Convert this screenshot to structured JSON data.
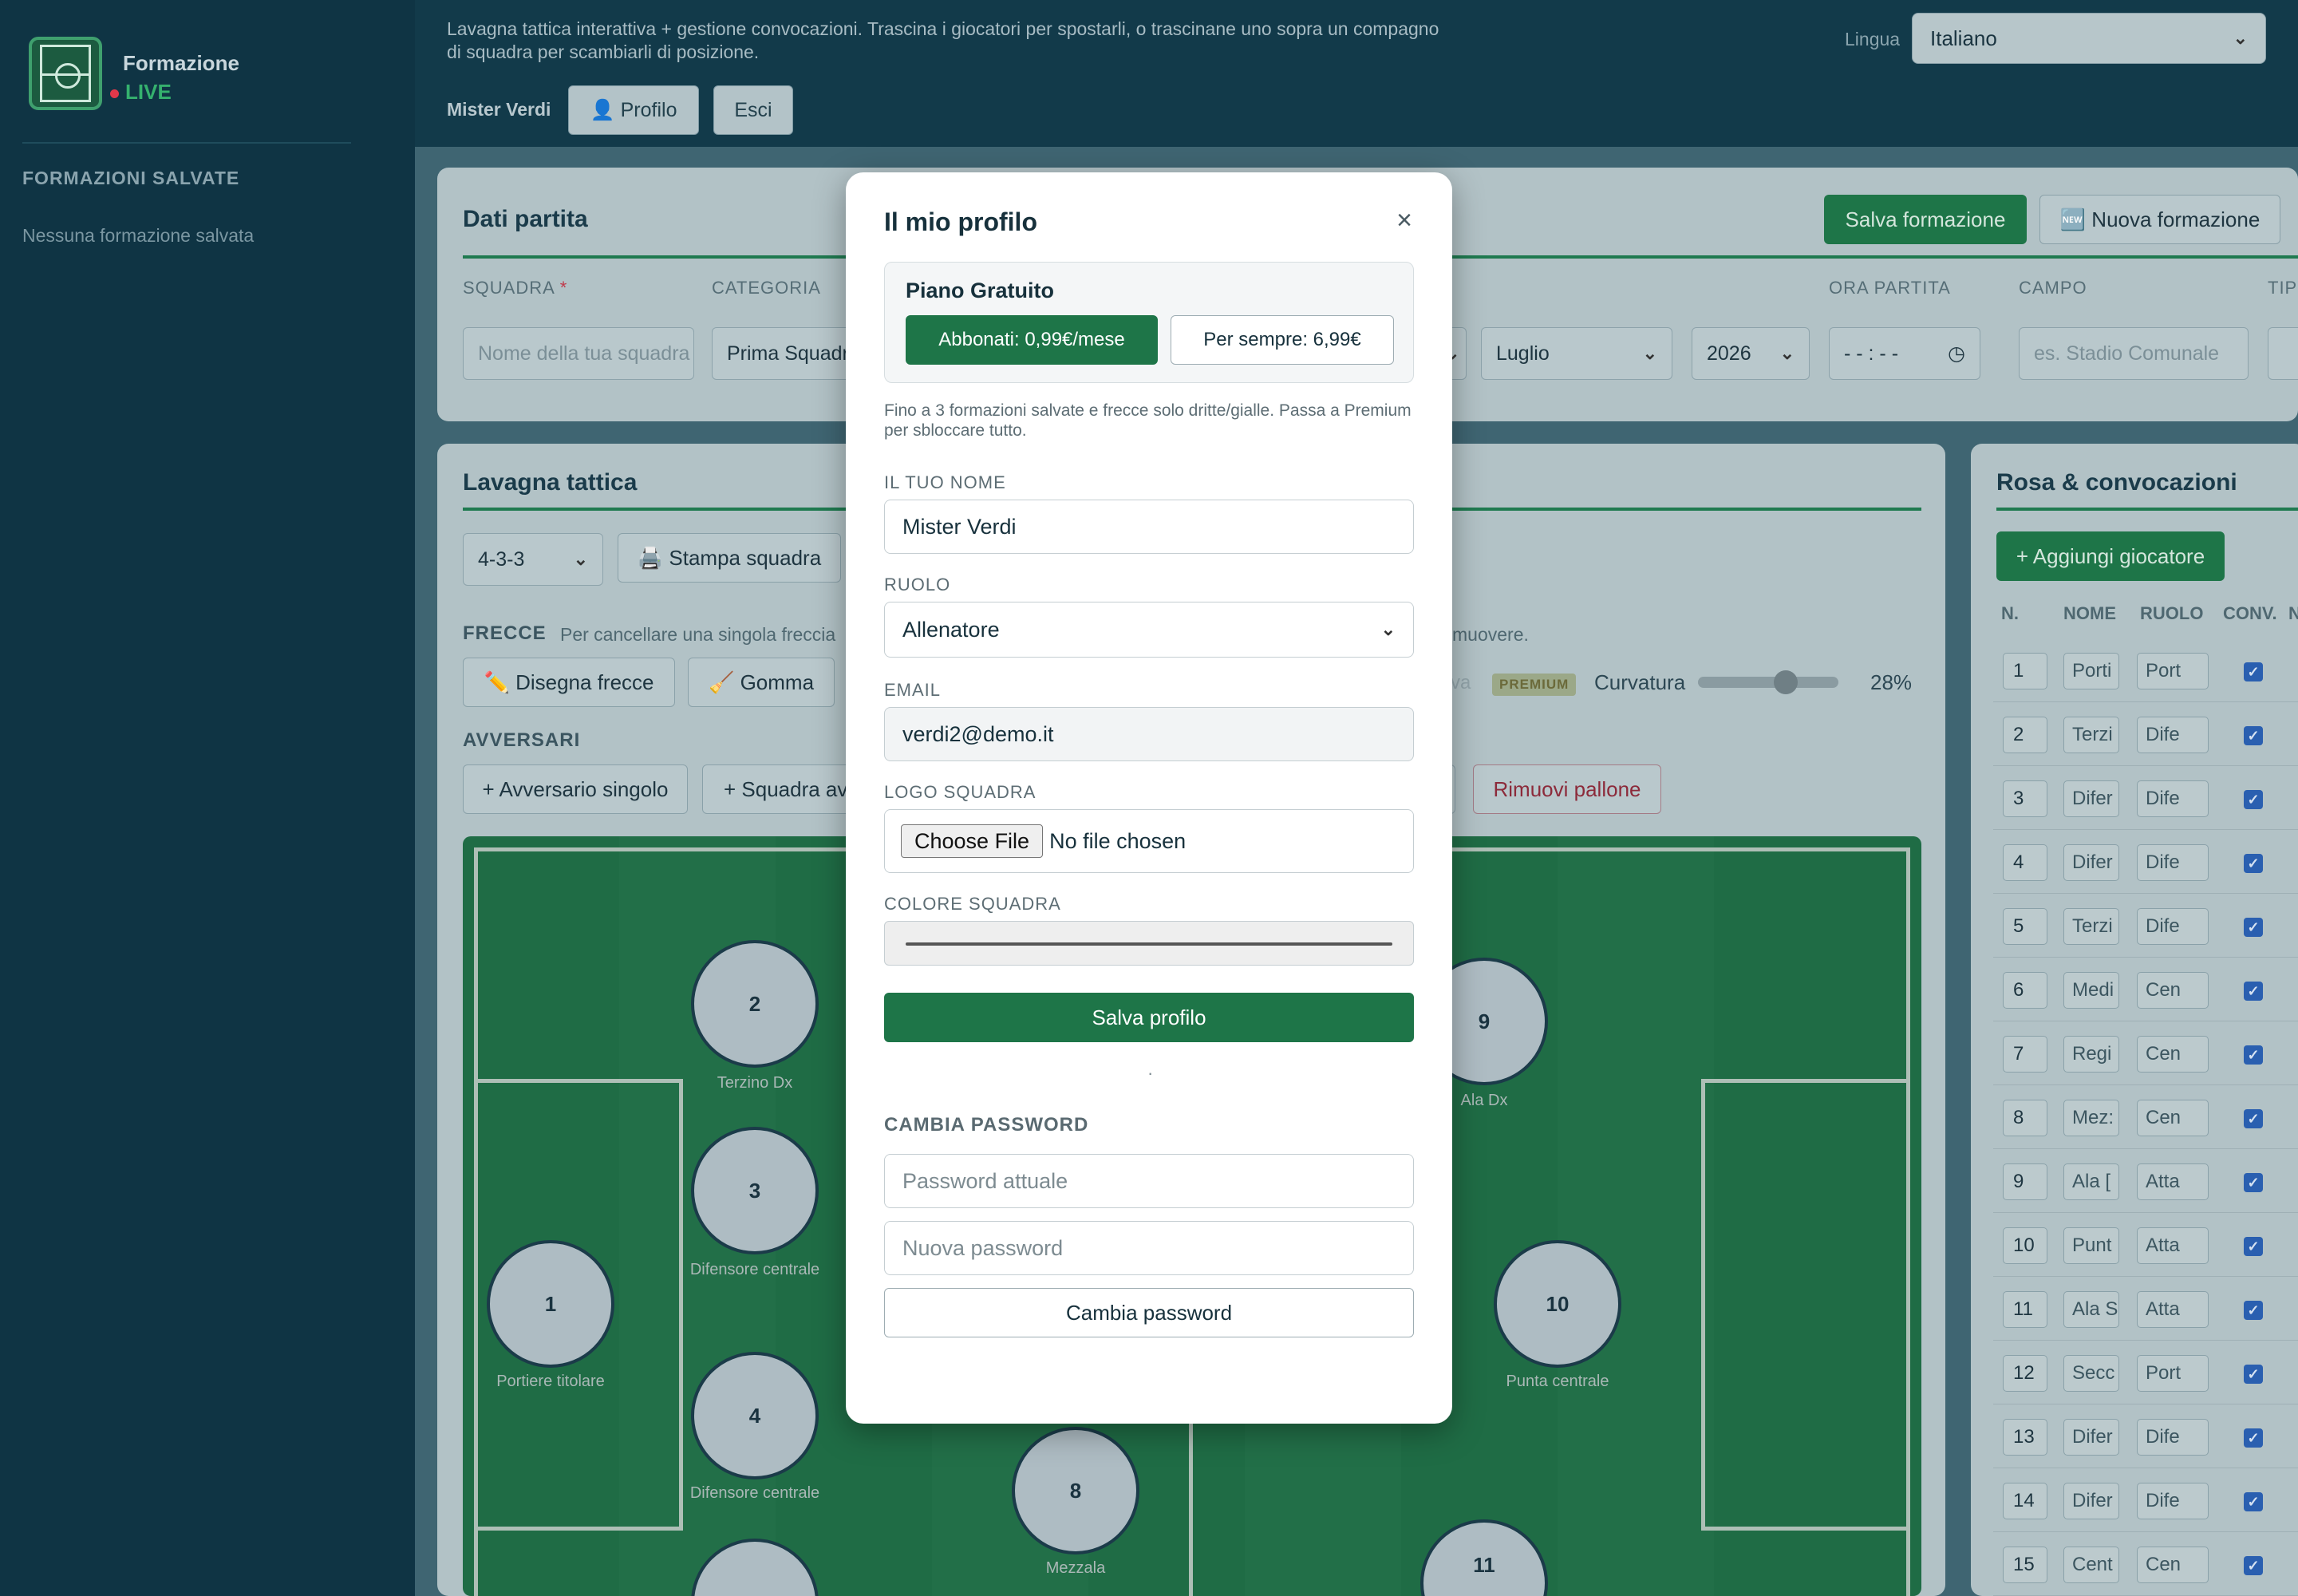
{
  "sidebar": {
    "brand": "Formazione",
    "live": "LIVE",
    "section_title": "FORMAZIONI SALVATE",
    "empty_text": "Nessuna formazione salvata"
  },
  "topbar": {
    "description": "Lavagna tattica interattiva + gestione convocazioni. Trascina i giocatori per spostarli, o trascinane uno sopra un compagno di squadra per scambiarli di posizione.",
    "user_name": "Mister Verdi",
    "profile_button": "👤 Profilo",
    "logout_button": "Esci",
    "language_label": "Lingua",
    "language_value": "Italiano"
  },
  "match": {
    "title": "Dati partita",
    "save_button": "Salva formazione",
    "new_button": "🆕 Nuova formazione",
    "fields": {
      "squadra_label": "SQUADRA",
      "squadra_placeholder": "Nome della tua squadra",
      "categoria_label": "CATEGORIA",
      "categoria_value": "Prima Squadra",
      "month_value": "Luglio",
      "year_value": "2026",
      "ora_label": "ORA PARTITA",
      "ora_value": "- - : - -",
      "campo_label": "CAMPO",
      "campo_placeholder": "es. Stadio Comunale",
      "tipo_label": "TIP"
    }
  },
  "board": {
    "title": "Lavagna tattica",
    "formation_value": "4-3-3",
    "print_button": "🖨️ Stampa squadra",
    "arrows_label": "FRECCE",
    "arrows_hint": "Per cancellare una singola freccia",
    "arrows_hint_end": "muovere.",
    "draw_button": "✏️ Disegna frecce",
    "eraser_button": "🧹 Gomma",
    "curve_faded": "va",
    "premium_badge": "PREMIUM",
    "curvature_label": "Curvatura",
    "curvature_value": "28%",
    "curvature_fraction": 0.65,
    "opponents_label": "AVVERSARI",
    "single_opponent_button": "+ Avversario singolo",
    "team_opponent_button": "+ Squadra av",
    "remove_ball_button": "Rimuovi pallone",
    "players": [
      {
        "number": "1",
        "role": "Portiere titolare"
      },
      {
        "number": "2",
        "role": "Terzino Dx"
      },
      {
        "number": "3",
        "role": "Difensore centrale"
      },
      {
        "number": "4",
        "role": "Difensore centrale"
      },
      {
        "number": "8",
        "role": "Mezzala"
      },
      {
        "number": "9",
        "role": "Ala Dx"
      },
      {
        "number": "10",
        "role": "Punta centrale"
      },
      {
        "number": "11",
        "role": ""
      }
    ]
  },
  "roster": {
    "title": "Rosa & convocazioni",
    "add_button": "+ Aggiungi giocatore",
    "headers": [
      "N.",
      "NOME",
      "RUOLO",
      "CONV.",
      "N"
    ],
    "rows": [
      {
        "n": "1",
        "name": "Porti",
        "role": "Port"
      },
      {
        "n": "2",
        "name": "Terzi",
        "role": "Dife"
      },
      {
        "n": "3",
        "name": "Difer",
        "role": "Dife"
      },
      {
        "n": "4",
        "name": "Difer",
        "role": "Dife"
      },
      {
        "n": "5",
        "name": "Terzi",
        "role": "Dife"
      },
      {
        "n": "6",
        "name": "Medi",
        "role": "Cen"
      },
      {
        "n": "7",
        "name": "Regi",
        "role": "Cen"
      },
      {
        "n": "8",
        "name": "Mez:",
        "role": "Cen"
      },
      {
        "n": "9",
        "name": "Ala [",
        "role": "Atta"
      },
      {
        "n": "10",
        "name": "Punt",
        "role": "Atta"
      },
      {
        "n": "11",
        "name": "Ala S",
        "role": "Atta"
      },
      {
        "n": "12",
        "name": "Secc",
        "role": "Port"
      },
      {
        "n": "13",
        "name": "Difer",
        "role": "Dife"
      },
      {
        "n": "14",
        "name": "Difer",
        "role": "Dife"
      },
      {
        "n": "15",
        "name": "Cent",
        "role": "Cen"
      }
    ]
  },
  "modal": {
    "title": "Il mio profilo",
    "close_icon": "×",
    "plan_title": "Piano Gratuito",
    "subscribe_button": "Abbonati: 0,99€/mese",
    "forever_button": "Per sempre: 6,99€",
    "plan_note": "Fino a 3 formazioni salvate e frecce solo dritte/gialle. Passa a Premium per sbloccare tutto.",
    "name_label": "IL TUO NOME",
    "name_value": "Mister Verdi",
    "role_label": "RUOLO",
    "role_value": "Allenatore",
    "email_label": "EMAIL",
    "email_value": "verdi2@demo.it",
    "logo_label": "LOGO SQUADRA",
    "file_button": "Choose File",
    "file_status": "No file chosen",
    "color_label": "COLORE SQUADRA",
    "save_button": "Salva profilo",
    "status_dot": "·",
    "password_section": "CAMBIA PASSWORD",
    "current_password_placeholder": "Password attuale",
    "new_password_placeholder": "Nuova password",
    "change_password_button": "Cambia password"
  }
}
